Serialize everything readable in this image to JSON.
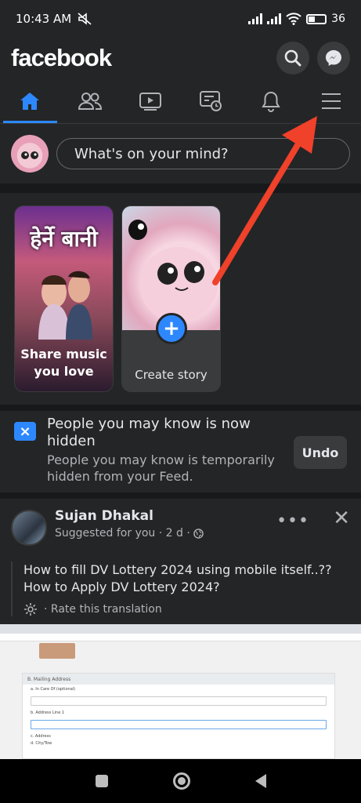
{
  "status_bar": {
    "time": "10:43 AM",
    "battery": "36"
  },
  "header": {
    "logo": "facebook",
    "icons": [
      "search-icon",
      "messenger-icon"
    ]
  },
  "nav": {
    "tabs": [
      "home-icon",
      "friends-icon",
      "watch-icon",
      "marketplace-icon",
      "notifications-icon",
      "menu-icon"
    ],
    "active": "home"
  },
  "composer": {
    "placeholder": "What's on your mind?"
  },
  "stories": [
    {
      "poster_title": "हेर्ने बानी",
      "label": "Share music you love"
    },
    {
      "label": "Create story"
    }
  ],
  "pymk": {
    "title": "People you may know is now hidden",
    "subtitle": "People you may know is temporarily hidden from your Feed.",
    "undo_label": "Undo"
  },
  "post": {
    "author": "Sujan Dhakal",
    "meta": "Suggested for you · 2 d ·",
    "text": "How to fill DV Lottery 2024 using mobile itself..?? How to Apply DV Lottery 2024?",
    "rate_label": "· Rate this translation",
    "form_heading": "B. Mailing Address",
    "form_labels": [
      "a. In Care Of (optional)",
      "b. Address Line 1",
      "c. Address",
      "d. City/Tow"
    ]
  },
  "colors": {
    "accent": "#2d88ff",
    "annotation_arrow": "#f0412a",
    "bg": "#18191a",
    "surface": "#242526"
  }
}
